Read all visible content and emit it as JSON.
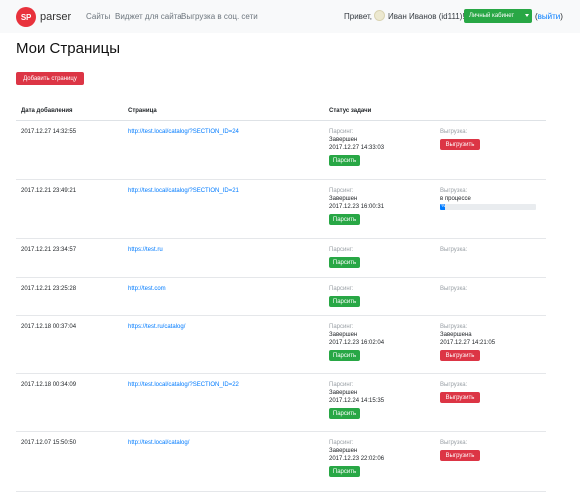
{
  "navbar": {
    "logo_text": "SP",
    "brand": "parser",
    "links": [
      "Сайты",
      "Виджет для сайта",
      "Выгрузка в соц. сети"
    ],
    "greeting": "Привет,",
    "user": "Иван Иванов (id111)!",
    "cabinet_button": "Личный кабинет",
    "logout_open": "(",
    "logout": "выйти",
    "logout_close": ")"
  },
  "page": {
    "title": "Мои Страницы",
    "add_button": "Добавить страницу"
  },
  "table": {
    "columns": [
      "Дата добавления",
      "Страница",
      "Статус задачи"
    ],
    "parse_label": "Парсинг:",
    "export_label": "Выгрузка:",
    "parse_button": "Парсить",
    "export_button": "Выгрузить",
    "rows": [
      {
        "date": "2017.12.27 14:32:55",
        "url": "http://test.local/catalog/?SECTION_ID=24",
        "parse_status": "Завершен",
        "parse_time": "2017.12.27 14:33:03",
        "export_status": "",
        "export_time": "",
        "export_button": true,
        "progress": null
      },
      {
        "date": "2017.12.21 23:49:21",
        "url": "http://test.local/catalog/?SECTION_ID=21",
        "parse_status": "Завершен",
        "parse_time": "2017.12.23 16:00:31",
        "export_status": "в процессе",
        "export_time": "",
        "export_button": false,
        "progress": 0.05,
        "progress_text": "%"
      },
      {
        "date": "2017.12.21 23:34:57",
        "url": "https://test.ru",
        "parse_status": "",
        "parse_time": "",
        "export_status": "",
        "export_time": "",
        "export_button": false,
        "progress": null
      },
      {
        "date": "2017.12.21 23:25:28",
        "url": "http://test.com",
        "parse_status": "",
        "parse_time": "",
        "export_status": "",
        "export_time": "",
        "export_button": false,
        "progress": null
      },
      {
        "date": "2017.12.18 00:37:04",
        "url": "https://test.ru/catalog/",
        "parse_status": "Завершен",
        "parse_time": "2017.12.23 16:02:04",
        "export_status": "Завершена",
        "export_time": "2017.12.27 14:21:05",
        "export_button": true,
        "progress": null
      },
      {
        "date": "2017.12.18 00:34:09",
        "url": "http://test.local/catalog/?SECTION_ID=22",
        "parse_status": "Завершен",
        "parse_time": "2017.12.24 14:15:35",
        "export_status": "",
        "export_time": "",
        "export_button": true,
        "progress": null
      },
      {
        "date": "2017.12.07 15:50:50",
        "url": "http://test.local/catalog/",
        "parse_status": "Завершен",
        "parse_time": "2017.12.23 22:02:06",
        "export_status": "",
        "export_time": "",
        "export_button": true,
        "progress": null
      }
    ]
  },
  "colors": {
    "green": "#28a745",
    "red": "#dc3545",
    "link": "#007bff",
    "logo": "#e8323c"
  }
}
